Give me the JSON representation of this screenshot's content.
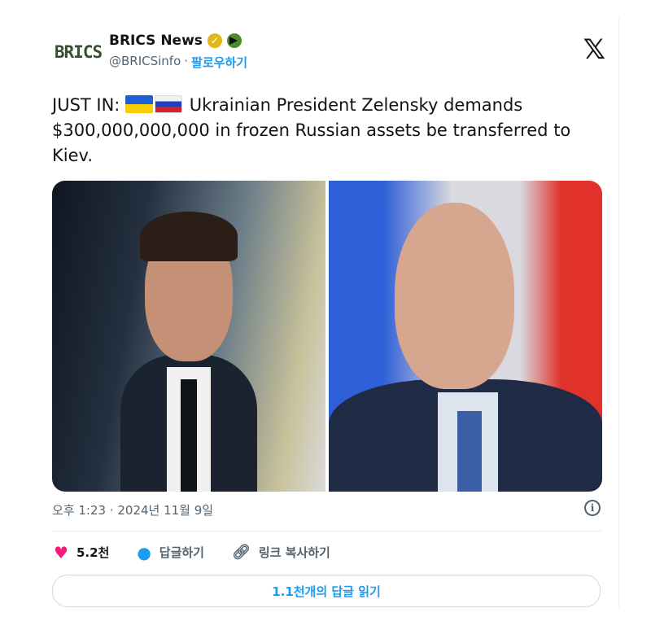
{
  "account": {
    "avatar_text": "BRICS",
    "name": "BRICS News",
    "handle": "@BRICSinfo",
    "separator": "·",
    "follow_label": "팔로우하기"
  },
  "tweet": {
    "prefix": "JUST IN:",
    "text": "Ukrainian President Zelensky demands $300,000,000,000 in frozen Russian assets be transferred to Kiev.",
    "flags": [
      "Ukraine flag",
      "Russia flag"
    ]
  },
  "meta": {
    "timestamp": "오후 1:23 · 2024년 11월 9일"
  },
  "actions": {
    "likes": "5.2천",
    "reply_label": "답글하기",
    "copy_link_label": "링크 복사하기"
  },
  "read_replies_label": "1.1천개의 답글 읽기",
  "icons": {
    "x_logo": "x-logo-icon",
    "info": "info-icon",
    "heart": "heart-icon",
    "reply": "speech-bubble-icon",
    "link": "link-icon"
  },
  "colors": {
    "accent": "#1d9bf0",
    "like": "#f91880",
    "verified": "#e2b719"
  }
}
